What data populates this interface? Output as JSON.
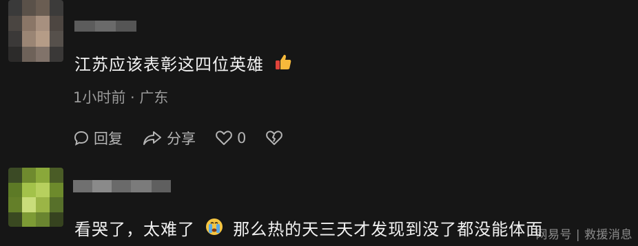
{
  "comments": [
    {
      "text": "江苏应该表彰这四位英雄",
      "emoji": "thumbs-up",
      "time_location": "1小时前 · 广东",
      "actions": {
        "reply_label": "回复",
        "share_label": "分享",
        "like_count": "0"
      }
    },
    {
      "text": "看哭了，太难了",
      "emoji": "crying-face",
      "text_after_emoji": "那么热的天三天才发现到没了都没能体面"
    }
  ],
  "watermark": "网易号 | 救援消息",
  "colors": {
    "background": "#161616",
    "text": "#f2f2f2",
    "meta": "#9a9a9a",
    "action": "#b5b5b5"
  }
}
